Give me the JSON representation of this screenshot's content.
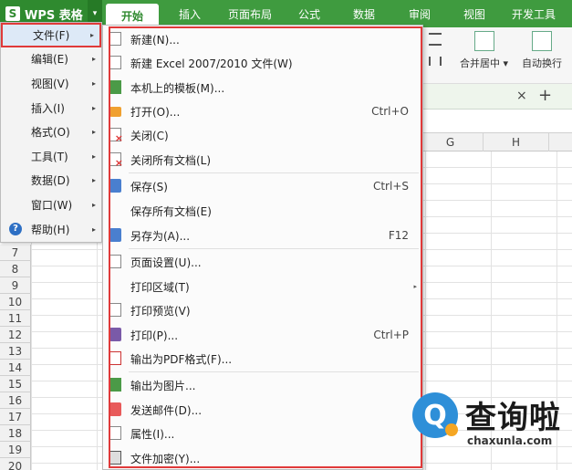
{
  "app": {
    "logo": "S",
    "name": "WPS 表格"
  },
  "tabs": [
    "开始",
    "插入",
    "页面布局",
    "公式",
    "数据",
    "审阅",
    "视图",
    "开发工具"
  ],
  "ribbon": {
    "merge_label": "合并居中",
    "merge_caret": "▾",
    "wrap_label": "自动换行"
  },
  "doc_tab": {
    "close": "×",
    "add": "+"
  },
  "columns": [
    "G",
    "H"
  ],
  "rows": [
    "7",
    "8",
    "9",
    "10",
    "11",
    "12",
    "13",
    "14",
    "15",
    "16",
    "17",
    "18",
    "19",
    "20"
  ],
  "main_menu": [
    {
      "label": "文件(F)",
      "arrow": "▸"
    },
    {
      "label": "编辑(E)",
      "arrow": "▸"
    },
    {
      "label": "视图(V)",
      "arrow": "▸"
    },
    {
      "label": "插入(I)",
      "arrow": "▸"
    },
    {
      "label": "格式(O)",
      "arrow": "▸"
    },
    {
      "label": "工具(T)",
      "arrow": "▸"
    },
    {
      "label": "数据(D)",
      "arrow": "▸"
    },
    {
      "label": "窗口(W)",
      "arrow": "▸"
    },
    {
      "label": "帮助(H)",
      "arrow": "▸"
    }
  ],
  "help_icon": "?",
  "file_menu": [
    {
      "label": "新建(N)...",
      "shortcut": "",
      "icon": "new-document-icon"
    },
    {
      "label": "新建 Excel 2007/2010 文件(W)",
      "shortcut": "",
      "icon": "new-excel-file-icon"
    },
    {
      "label": "本机上的模板(M)...",
      "shortcut": "",
      "icon": "template-icon"
    },
    {
      "label": "打开(O)...",
      "shortcut": "Ctrl+O",
      "icon": "open-folder-icon"
    },
    {
      "label": "关闭(C)",
      "shortcut": "",
      "icon": "close-document-icon"
    },
    {
      "label": "关闭所有文档(L)",
      "shortcut": "",
      "icon": "close-all-documents-icon"
    },
    {
      "label": "保存(S)",
      "shortcut": "Ctrl+S",
      "icon": "save-icon"
    },
    {
      "label": "保存所有文档(E)",
      "shortcut": "",
      "icon": "save-all-icon"
    },
    {
      "label": "另存为(A)...",
      "shortcut": "F12",
      "icon": "save-as-icon"
    },
    {
      "label": "页面设置(U)...",
      "shortcut": "",
      "icon": "page-setup-icon"
    },
    {
      "label": "打印区域(T)",
      "shortcut": "",
      "icon": "print-area-icon"
    },
    {
      "label": "打印预览(V)",
      "shortcut": "",
      "icon": "print-preview-icon"
    },
    {
      "label": "打印(P)...",
      "shortcut": "Ctrl+P",
      "icon": "print-icon"
    },
    {
      "label": "输出为PDF格式(F)...",
      "shortcut": "",
      "icon": "export-pdf-icon"
    },
    {
      "label": "输出为图片...",
      "shortcut": "",
      "icon": "export-image-icon"
    },
    {
      "label": "发送邮件(D)...",
      "shortcut": "",
      "icon": "send-mail-icon"
    },
    {
      "label": "属性(I)...",
      "shortcut": "",
      "icon": "properties-icon"
    },
    {
      "label": "文件加密(Y)...",
      "shortcut": "",
      "icon": "file-encrypt-icon"
    }
  ],
  "submenu_arrow": "▸",
  "watermark": {
    "glyph": "Q",
    "text": "查询啦",
    "url": "chaxunla.com"
  },
  "colors": {
    "ribbon_green": "#3f9b3f",
    "highlight_red": "#e03a3a",
    "watermark_blue": "#2e8fd8",
    "watermark_orange": "#f5a623"
  }
}
